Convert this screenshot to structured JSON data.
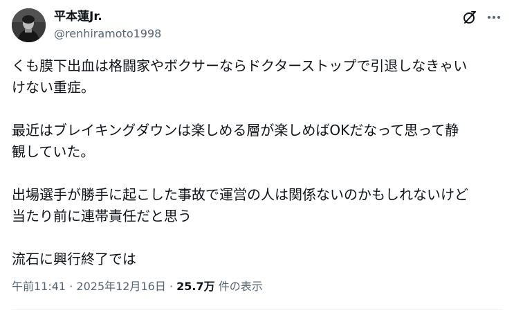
{
  "tweet": {
    "author": {
      "display_name": "平本蓮Jr.",
      "handle": "@renhiramoto1998",
      "avatar_icon": "profile-photo"
    },
    "header_icons": {
      "grok": "grok-icon",
      "more": "more-icon"
    },
    "paragraphs": [
      {
        "lines": [
          "くも膜下出血は格闘家やボクサーならドクターストップで引退しなきゃい",
          "けない重症。"
        ]
      },
      {
        "lines": [
          "最近はブレイキングダウンは楽しめる層が楽しめばOKだなって思って静",
          "観していた。"
        ]
      },
      {
        "lines": [
          "出場選手が勝手に起こした事故で運営の人は関係ないのかもしれないけど",
          "当たり前に連帯責任だと思う"
        ]
      },
      {
        "lines": [
          "流石に興行終了では"
        ]
      }
    ],
    "meta": {
      "time": "午前11:41",
      "separator": "·",
      "date": "2025年12月16日",
      "views_count": "25.7万",
      "views_label": "件の表示"
    }
  },
  "colors": {
    "text_primary": "#0f1419",
    "text_secondary": "#536471",
    "divider": "#eff3f4",
    "background": "#ffffff"
  }
}
